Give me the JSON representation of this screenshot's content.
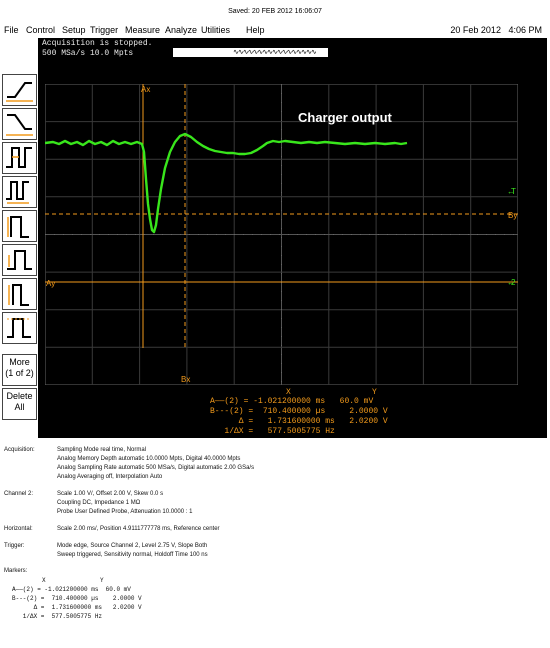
{
  "saved_text": "Saved: 20 FEB 2012  16:06:07",
  "menu": [
    "File",
    "Control",
    "Setup",
    "Trigger",
    "Measure",
    "Analyze",
    "Utilities",
    "Help"
  ],
  "header_date": "20 Feb 2012",
  "header_time": "4:06 PM",
  "status": {
    "line1": "Acquisition is stopped.",
    "line2": "500 MSa/s    10.0 Mpts"
  },
  "plot_label": "Charger output",
  "markers": {
    "ax": "Ax",
    "bx": "Bx",
    "ay": "Ay",
    "by": "By",
    "trigger": "T",
    "channel": "2"
  },
  "softkeys": {
    "more_label": "More",
    "more_sub": "(1 of 2)",
    "delete_label": "Delete",
    "delete_sub": "All"
  },
  "marker_readout": {
    "col_x": "X",
    "col_y": "Y",
    "rows": [
      {
        "label": "A——(2) =",
        "x": "-1.021200000 ms",
        "y": "60.0 mV"
      },
      {
        "label": "B---(2) =",
        "x": " 710.400000 µs",
        "y": "2.0000 V"
      },
      {
        "label": "      Δ =",
        "x": "  1.731600000 ms",
        "y": "2.0200 V"
      },
      {
        "label": "   1/ΔX =",
        "x": "  577.5005775 Hz",
        "y": ""
      }
    ]
  },
  "details": {
    "acquisition": {
      "label": "Acquisition:",
      "lines": [
        "Sampling Mode real time, Normal",
        "Analog Memory Depth automatic 10.0000 Mpts, Digital 40.0000 Mpts",
        "Analog Sampling Rate automatic 500 MSa/s, Digital automatic 2.00 GSa/s",
        "Analog Averaging off, Interpolation Auto"
      ]
    },
    "channel2": {
      "label": "Channel 2:",
      "lines": [
        "Scale 1.00 V/, Offset 2.00 V, Skew 0.0 s",
        "Coupling DC, Impedance 1 MΩ",
        "Probe User Defined Probe, Attenuation 10.0000 : 1"
      ]
    },
    "horizontal": {
      "label": "Horizontal:",
      "lines": [
        "Scale 2.00 ms/, Position 4.9111777778 ms, Reference center"
      ]
    },
    "trigger": {
      "label": "Trigger:",
      "lines": [
        "Mode edge, Source Channel 2, Level 2.75 V, Slope Both",
        "Sweep triggered, Sensitivity normal, Holdoff Time 100 ns"
      ]
    },
    "markers_label": "Markers:",
    "markers_table": {
      "header_x": "X",
      "header_y": "Y",
      "rows": [
        {
          "label": "A——(2) =",
          "x": "-1.021200000 ms",
          "y": "60.0 mV"
        },
        {
          "label": "B---(2) =",
          "x": " 710.400000 µs",
          "y": "2.0000 V"
        },
        {
          "label": "      Δ =",
          "x": " 1.731600000 ms",
          "y": "2.0200 V"
        },
        {
          "label": "   1/ΔX =",
          "x": " 577.5005775 Hz",
          "y": ""
        }
      ]
    }
  },
  "colors": {
    "trace": "#39e61c",
    "marker": "#f29a1b",
    "grid": "#3a3a3a",
    "background": "#000000"
  }
}
